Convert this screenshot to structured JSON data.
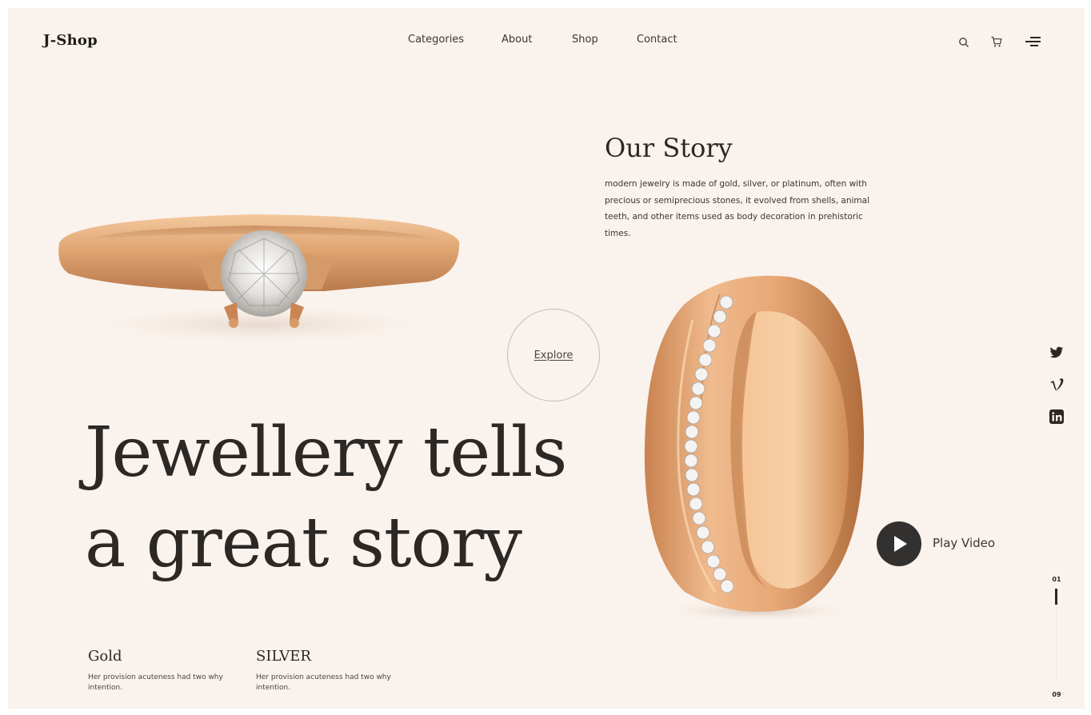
{
  "brand": {
    "logo_text": "J-Shop"
  },
  "nav": {
    "items": [
      "Categories",
      "About",
      "Shop",
      "Contact"
    ]
  },
  "header_icons": [
    "search-icon",
    "cart-icon",
    "menu-icon"
  ],
  "story": {
    "title": "Our Story",
    "text": "modern jewelry is made of gold, silver, or platinum, often with precious or semiprecious stones, it evolved from shells, animal teeth, and other items used as body decoration in prehistoric times."
  },
  "explore": {
    "label": "Explore"
  },
  "hero": {
    "line1": "Jewellery tells",
    "line2": "a great story"
  },
  "features": [
    {
      "title": "Gold",
      "text": "Her provision acuteness had two why intention."
    },
    {
      "title": "SILVER",
      "text": "Her provision acuteness had two why intention."
    }
  ],
  "video": {
    "label": "Play Video"
  },
  "social": [
    "twitter-icon",
    "vimeo-icon",
    "linkedin-icon"
  ],
  "pager": {
    "current": "01",
    "total": "09",
    "progress": 0.15
  },
  "colors": {
    "background": "#faf2ec",
    "text": "#2b2826",
    "gold": "#d9a273",
    "play_button": "#333130"
  }
}
